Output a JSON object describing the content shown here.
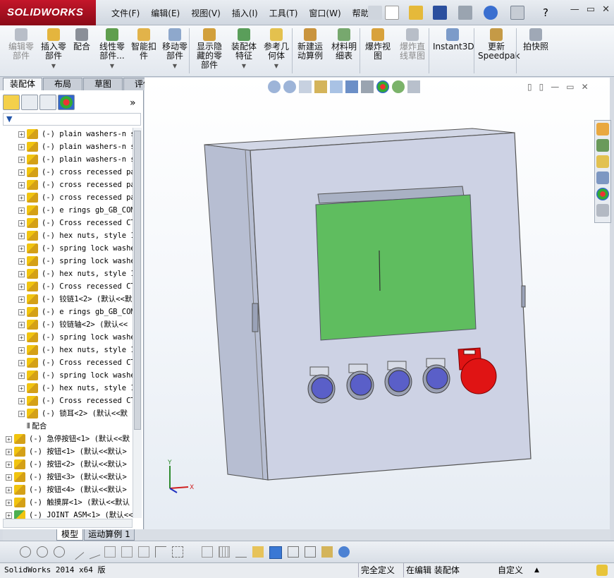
{
  "app": {
    "brand": "SOLIDWORKS"
  },
  "menu": [
    "文件(F)",
    "编辑(E)",
    "视图(V)",
    "插入(I)",
    "工具(T)",
    "窗口(W)",
    "帮助(H)"
  ],
  "ribbon": [
    {
      "label": "编辑零部件",
      "enabled": false,
      "icon": "edit-component-icon"
    },
    {
      "label": "插入零部件",
      "enabled": true,
      "icon": "insert-component-icon",
      "dropdown": true
    },
    {
      "label": "配合",
      "enabled": true,
      "icon": "mate-icon"
    },
    {
      "label": "线性零部件...",
      "enabled": true,
      "icon": "linear-pattern-icon",
      "dropdown": true
    },
    {
      "label": "智能扣件",
      "enabled": true,
      "icon": "smart-fasteners-icon"
    },
    {
      "label": "移动零部件",
      "enabled": true,
      "icon": "move-component-icon",
      "dropdown": true
    },
    {
      "label": "显示隐藏的零部件",
      "enabled": true,
      "icon": "show-hidden-icon"
    },
    {
      "label": "装配体特征",
      "enabled": true,
      "icon": "assembly-features-icon",
      "dropdown": true
    },
    {
      "label": "参考几何体",
      "enabled": true,
      "icon": "reference-geometry-icon",
      "dropdown": true
    },
    {
      "label": "新建运动算例",
      "enabled": true,
      "icon": "new-motion-study-icon"
    },
    {
      "label": "材料明细表",
      "enabled": true,
      "icon": "bom-icon"
    },
    {
      "label": "爆炸视图",
      "enabled": true,
      "icon": "exploded-view-icon"
    },
    {
      "label": "爆炸直线草图",
      "enabled": false,
      "icon": "explode-line-sketch-icon"
    },
    {
      "label": "Instant3D",
      "enabled": true,
      "icon": "instant3d-icon"
    },
    {
      "label": "更新Speedpak",
      "enabled": true,
      "icon": "speedpak-icon"
    },
    {
      "label": "拍快照",
      "enabled": true,
      "icon": "snapshot-icon"
    }
  ],
  "command_tabs": [
    "装配体",
    "布局",
    "草图",
    "评估"
  ],
  "active_command_tab": "装配体",
  "collapse_glyph": "»",
  "tree": {
    "items": [
      {
        "text": "(-) plain washers-n s",
        "level": 2,
        "kind": "part"
      },
      {
        "text": "(-) plain washers-n s",
        "level": 2,
        "kind": "part"
      },
      {
        "text": "(-) plain washers-n s",
        "level": 2,
        "kind": "part"
      },
      {
        "text": "(-) cross recessed pa",
        "level": 2,
        "kind": "part"
      },
      {
        "text": "(-) cross recessed pa",
        "level": 2,
        "kind": "part"
      },
      {
        "text": "(-) cross recessed pa",
        "level": 2,
        "kind": "part"
      },
      {
        "text": "(-) e rings gb_GB_COM",
        "level": 2,
        "kind": "part"
      },
      {
        "text": "(-) Cross recessed CT",
        "level": 2,
        "kind": "part"
      },
      {
        "text": "(-) hex nuts, style 1",
        "level": 2,
        "kind": "part"
      },
      {
        "text": "(-) spring lock washe",
        "level": 2,
        "kind": "part"
      },
      {
        "text": "(-) spring lock washe",
        "level": 2,
        "kind": "part"
      },
      {
        "text": "(-) hex nuts, style 1",
        "level": 2,
        "kind": "part"
      },
      {
        "text": "(-) Cross recessed CT",
        "level": 2,
        "kind": "part"
      },
      {
        "text": "(-) 铰链1<2> (默认<<默",
        "level": 2,
        "kind": "part"
      },
      {
        "text": "(-) e rings gb_GB_COM",
        "level": 2,
        "kind": "part"
      },
      {
        "text": "(-) 铰链轴<2> (默认<<",
        "level": 2,
        "kind": "part"
      },
      {
        "text": "(-) spring lock washe",
        "level": 2,
        "kind": "part"
      },
      {
        "text": "(-) hex nuts, style 1",
        "level": 2,
        "kind": "part"
      },
      {
        "text": "(-) Cross recessed CT",
        "level": 2,
        "kind": "part"
      },
      {
        "text": "(-) spring lock washe",
        "level": 2,
        "kind": "part"
      },
      {
        "text": "(-) hex nuts, style 1",
        "level": 2,
        "kind": "part"
      },
      {
        "text": "(-) Cross recessed CT",
        "level": 2,
        "kind": "part"
      },
      {
        "text": "(-) 锁耳<2> (默认<<默",
        "level": 2,
        "kind": "part"
      },
      {
        "text": "配合",
        "level": 2,
        "kind": "mates"
      },
      {
        "text": "(-) 急停按钮<1> (默认<<默",
        "level": 1,
        "kind": "part"
      },
      {
        "text": "(-) 按钮<1> (默认<<默认>",
        "level": 1,
        "kind": "part"
      },
      {
        "text": "(-) 按钮<2> (默认<<默认>",
        "level": 1,
        "kind": "part"
      },
      {
        "text": "(-) 按钮<3> (默认<<默认>",
        "level": 1,
        "kind": "part"
      },
      {
        "text": "(-) 按钮<4> (默认<<默认>",
        "level": 1,
        "kind": "part"
      },
      {
        "text": "(-) 触摸屏<1> (默认<<默认",
        "level": 1,
        "kind": "part"
      },
      {
        "text": "(-) JOINT ASM<1> (默认<<默",
        "level": 1,
        "kind": "assembly"
      }
    ]
  },
  "axes": {
    "x": "X",
    "y": "Y"
  },
  "bottom_tabs": [
    "模型",
    "运动算例 1"
  ],
  "active_bottom_tab": "模型",
  "status": {
    "left": "SolidWorks 2014 x64 版",
    "defined": "完全定义",
    "editing": "在编辑 装配体",
    "mode": "自定义"
  },
  "colors": {
    "screen": "#5fbd5f",
    "button_blue": "#5a5fc8",
    "estop_red": "#e01414",
    "cabinet": "#c9cfe0"
  }
}
